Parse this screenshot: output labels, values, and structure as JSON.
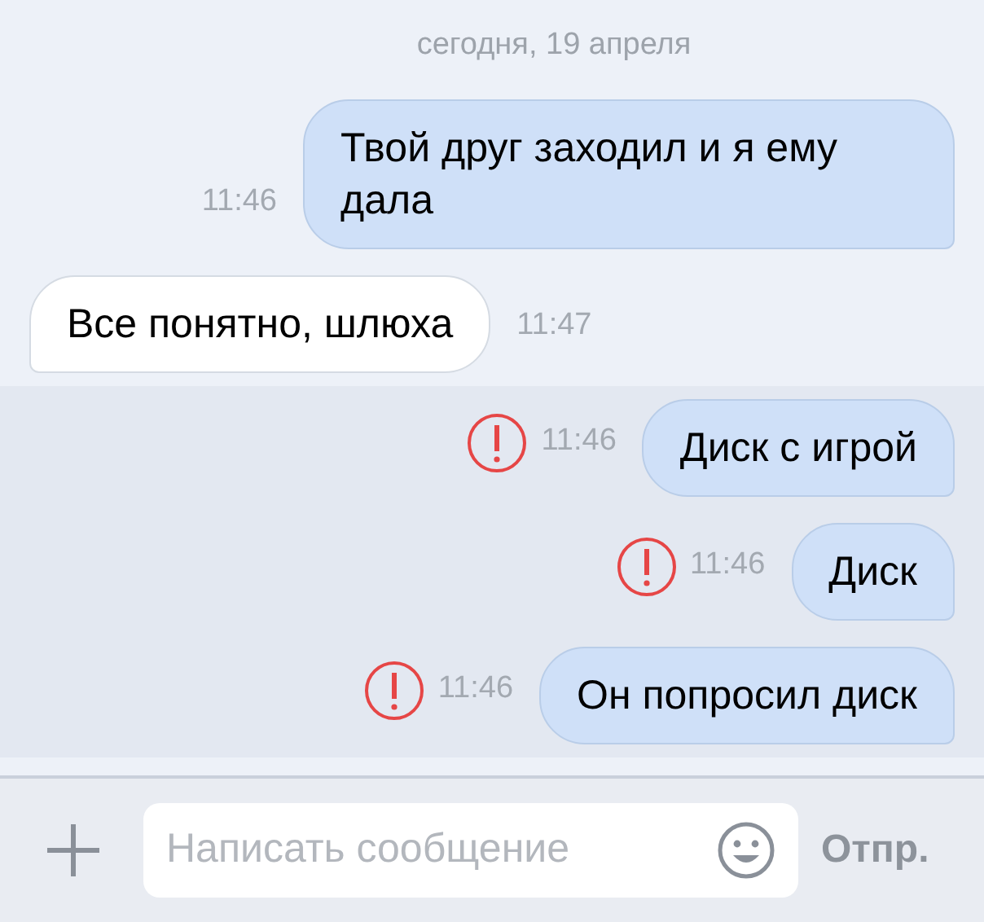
{
  "date_separator": "сегодня, 19 апреля",
  "messages": [
    {
      "kind": "outgoing",
      "text": "Твой друг заходил и я ему дала",
      "time": "11:46",
      "failed": false
    },
    {
      "kind": "incoming",
      "text": "Все понятно, шлюха",
      "time": "11:47",
      "failed": false
    },
    {
      "kind": "outgoing",
      "text": "Диск с игрой",
      "time": "11:46",
      "failed": true
    },
    {
      "kind": "outgoing",
      "text": "Диск",
      "time": "11:46",
      "failed": true
    },
    {
      "kind": "outgoing",
      "text": "Он попросил диск",
      "time": "11:46",
      "failed": true
    }
  ],
  "composer": {
    "placeholder": "Написать сообщение",
    "send_label": "Отпр."
  }
}
